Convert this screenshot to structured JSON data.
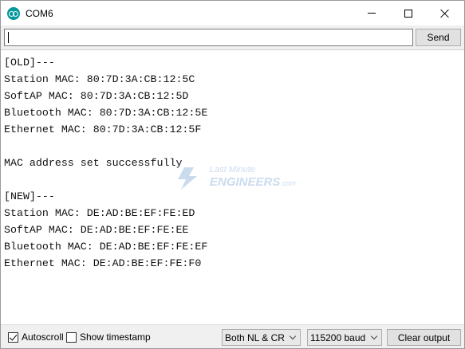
{
  "window": {
    "title": "COM6",
    "app_icon": "arduino-icon"
  },
  "send_bar": {
    "input_value": "",
    "send_label": "Send"
  },
  "output": {
    "lines": [
      "[OLD]---",
      "Station MAC: 80:7D:3A:CB:12:5C",
      "SoftAP MAC: 80:7D:3A:CB:12:5D",
      "Bluetooth MAC: 80:7D:3A:CB:12:5E",
      "Ethernet MAC: 80:7D:3A:CB:12:5F",
      "",
      "MAC address set successfully",
      "",
      "[NEW]---",
      "Station MAC: DE:AD:BE:EF:FE:ED",
      "SoftAP MAC: DE:AD:BE:EF:FE:EE",
      "Bluetooth MAC: DE:AD:BE:EF:FE:EF",
      "Ethernet MAC: DE:AD:BE:EF:FE:F0"
    ],
    "watermark": {
      "line1": "Last Minute",
      "line2": "ENGINEERS",
      "line3": ".com"
    }
  },
  "bottom_bar": {
    "autoscroll_label": "Autoscroll",
    "autoscroll_checked": true,
    "timestamp_label": "Show timestamp",
    "timestamp_checked": false,
    "line_ending": "Both NL & CR",
    "baud_rate": "115200 baud",
    "clear_label": "Clear output"
  },
  "colors": {
    "accent": "#00979d",
    "watermark": "#6a9ad0"
  }
}
